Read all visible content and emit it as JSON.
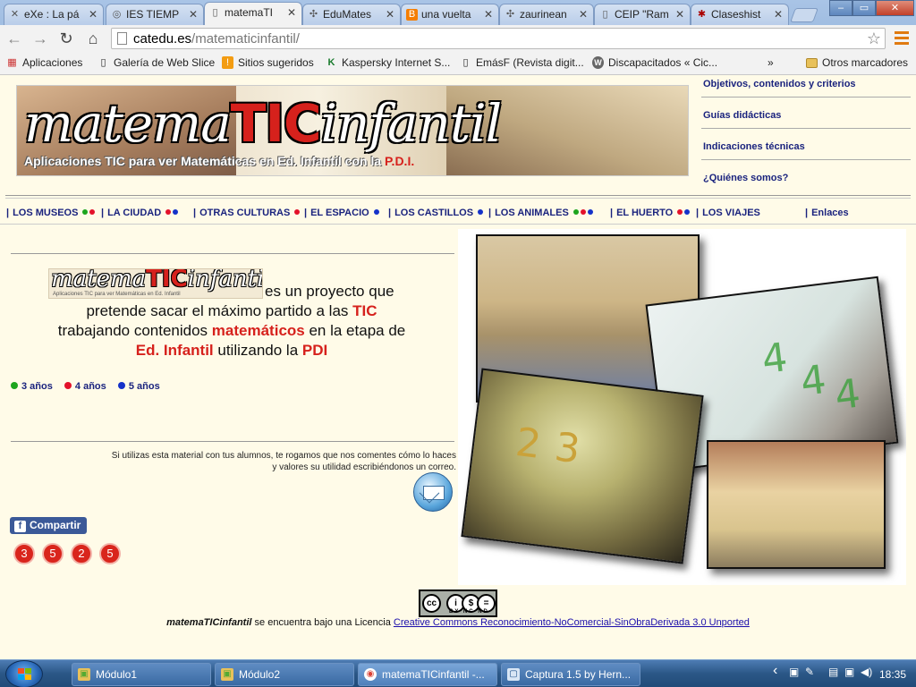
{
  "browser": {
    "tabs": [
      {
        "label": "eXe : La pá",
        "icon": "exe-icon",
        "fav": "✕"
      },
      {
        "label": "IES TIEMP",
        "icon": "globe-icon",
        "fav": "◎"
      },
      {
        "label": "matemaTI",
        "icon": "page-icon",
        "fav": "▯"
      },
      {
        "label": "EduMates",
        "icon": "pinwheel-icon",
        "fav": "✣"
      },
      {
        "label": "una vuelta",
        "icon": "blogger-icon",
        "fav": "B"
      },
      {
        "label": "zaurinean",
        "icon": "pinwheel-icon",
        "fav": "✣"
      },
      {
        "label": "CEIP \"Ram",
        "icon": "page-icon",
        "fav": "▯"
      },
      {
        "label": "Claseshist",
        "icon": "ball-icon",
        "fav": "✱"
      }
    ],
    "close_glyph": "✕",
    "window_controls": {
      "minimize": "–",
      "maximize": "▭",
      "close": "✕"
    },
    "nav": {
      "back": "←",
      "forward": "→",
      "reload": "↻",
      "home": "⌂"
    },
    "address": {
      "host": "catedu.es",
      "path": "/matematicinfantil/"
    },
    "star_glyph": "☆",
    "bookmarks": [
      {
        "label": "Aplicaciones",
        "icon": "apps-grid-icon",
        "glyph": "▦"
      },
      {
        "label": "Galería de Web Slice",
        "icon": "page-icon",
        "glyph": "▯"
      },
      {
        "label": "Sitios sugeridos",
        "icon": "idea-icon",
        "glyph": "!"
      },
      {
        "label": "Kaspersky Internet S...",
        "icon": "kaspersky-icon",
        "glyph": "K"
      },
      {
        "label": "EmásF (Revista digit...",
        "icon": "page-icon",
        "glyph": "▯"
      },
      {
        "label": "Discapacitados « Cic...",
        "icon": "wordpress-icon",
        "glyph": "W"
      }
    ],
    "more_glyph": "»",
    "other_bookmarks": "Otros marcadores"
  },
  "page": {
    "banner": {
      "logo_a": "matema",
      "logo_tic": "TIC",
      "logo_b": "infantil",
      "subtitle": "Aplicaciones TIC para ver Matemáticas en Ed. Infantil con la",
      "subtitle_pdi": "P.D.I."
    },
    "side_links": [
      "Objetivos, contenidos y criterios",
      "Guías didácticas",
      "Indicaciones técnicas",
      "¿Quiénes somos?"
    ],
    "menu": [
      {
        "label": "LOS MUSEOS",
        "dots": [
          "g",
          "r"
        ]
      },
      {
        "label": "LA CIUDAD",
        "dots": [
          "r",
          "b"
        ]
      },
      {
        "label": "OTRAS CULTURAS",
        "dots": [
          "r"
        ]
      },
      {
        "label": "EL ESPACIO",
        "dots": [
          "b"
        ]
      },
      {
        "label": "LOS CASTILLOS",
        "dots": [
          "b"
        ]
      },
      {
        "label": "LOS ANIMALES",
        "dots": [
          "g",
          "r",
          "b"
        ]
      },
      {
        "label": "EL HUERTO",
        "dots": [
          "r",
          "b"
        ]
      },
      {
        "label": "LOS VIAJES",
        "dots": []
      },
      {
        "label": "Enlaces",
        "dots": []
      }
    ],
    "menu_separator": "|",
    "intro_logo": {
      "a": "matema",
      "tic": "TIC",
      "b": "infantil",
      "sub": "Aplicaciones TIC para ver Matemáticas en Ed. Infantil"
    },
    "intro": {
      "t1": "es un proyecto que",
      "t2": "pretende sacar el máximo partido a las",
      "tic": "TIC",
      "t3": "trabajando contenidos",
      "mat": "matemáticos",
      "t4": "en la etapa de",
      "ed": "Ed. Infantil",
      "t5": "utilizando la",
      "pdi": "PDI"
    },
    "ages": [
      {
        "label": "3 años",
        "color": "#1da51d"
      },
      {
        "label": "4 años",
        "color": "#e3122a"
      },
      {
        "label": "5 años",
        "color": "#1532c9"
      }
    ],
    "note_line1": "Si utilizas esta material con tus alumnos, te rogamos que nos comentes cómo lo haces",
    "note_line2": "y valores su utilidad escribiéndonos un correo.",
    "share": {
      "glyph": "f",
      "label": "Compartir"
    },
    "counter": [
      "3",
      "5",
      "2",
      "5"
    ],
    "photo_glyphs": [
      "4",
      "4",
      "4",
      "2",
      "3"
    ],
    "license_badge": {
      "cc": "cc",
      "by": "i",
      "nc": "$",
      "nd": "=",
      "label": "BY NC ND"
    },
    "license": {
      "site": "matemaTICinfantil",
      "text": "se encuentra bajo una Licencia",
      "link": "Creative Commons Reconocimiento-NoComercial-SinObraDerivada 3.0 Unported"
    }
  },
  "taskbar": {
    "tasks": [
      {
        "label": "Módulo1",
        "icon": "folder-icon",
        "glyph": "▣"
      },
      {
        "label": "Módulo2",
        "icon": "folder-icon",
        "glyph": "▣"
      },
      {
        "label": "matemaTICinfantil -...",
        "icon": "chrome-icon",
        "glyph": "◉"
      },
      {
        "label": "Captura 1.5 by Hern...",
        "icon": "capture-icon",
        "glyph": "▢"
      }
    ],
    "tray": {
      "chevron": "‹",
      "network": "▣",
      "tools": "✎",
      "monitor": "▤",
      "speaker": "◀)"
    },
    "clock": "18:35"
  },
  "colors": {
    "accent": "#d6211c",
    "nav_text": "#1a237e",
    "page_bg": "#fffbe8"
  }
}
